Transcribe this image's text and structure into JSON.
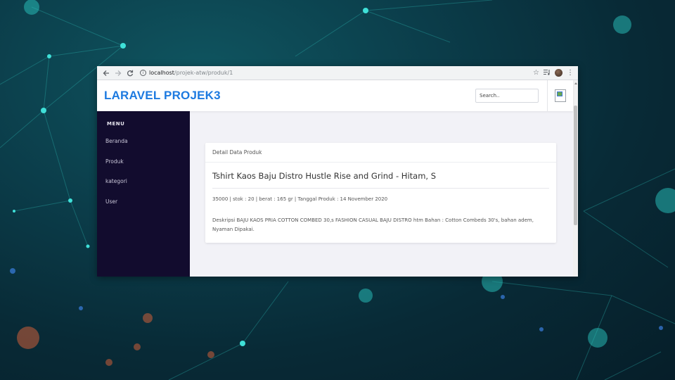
{
  "browser": {
    "url_host": "localhost",
    "url_path": "/projek-atw/produk/1",
    "icons": [
      "back-arrow-icon",
      "forward-arrow-icon",
      "reload-icon",
      "info-icon",
      "star-icon",
      "playlist-icon",
      "avatar",
      "kebab-menu-icon"
    ]
  },
  "header": {
    "brand": "LARAVEL PROJEK3",
    "search_placeholder": "Search.."
  },
  "sidebar": {
    "title": "MENU",
    "items": [
      {
        "label": "Beranda"
      },
      {
        "label": "Produk"
      },
      {
        "label": "kategori"
      },
      {
        "label": "User"
      }
    ]
  },
  "card": {
    "header": "Detail Data Produk",
    "product_title": "Tshirt Kaos Baju Distro Hustle Rise and Grind - Hitam, S",
    "meta": "35000 | stok : 20 | berat : 165 gr | Tanggal Produk : 14 November 2020",
    "description": "Deskripsi BAJU KAOS PRIA COTTON COMBED 30,s FASHION CASUAL BAJU DISTRO htm Bahan : Cotton Combeds 30's, bahan adem, Nyaman Dipakai."
  },
  "colors": {
    "brand": "#1d7ae0",
    "sidebar_bg": "#120c2e",
    "main_bg": "#f2f2f7"
  }
}
